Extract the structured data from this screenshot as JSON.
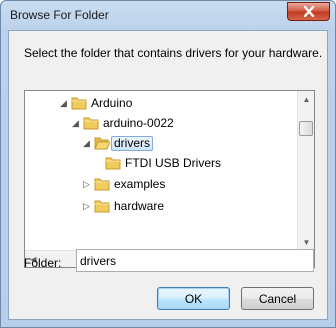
{
  "window": {
    "title": "Browse For Folder"
  },
  "dialog": {
    "prompt": "Select the folder that contains drivers for your hardware.",
    "tree": {
      "nodes": [
        {
          "label": "Arduino",
          "expander": "expanded"
        },
        {
          "label": "arduino-0022",
          "expander": "expanded"
        },
        {
          "label": "drivers",
          "expander": "expanded",
          "selected": true
        },
        {
          "label": "FTDI USB Drivers",
          "expander": "none"
        },
        {
          "label": "examples",
          "expander": "collapsed"
        },
        {
          "label": "hardware",
          "expander": "collapsed"
        }
      ]
    },
    "folder_label": "Folder:",
    "folder_value": "drivers",
    "ok_label": "OK",
    "cancel_label": "Cancel"
  },
  "colors": {
    "folder_fill": "#f1cb5b",
    "folder_edge": "#c79a2d",
    "selection": "#cde6fb",
    "close_button": "#c1391f"
  },
  "icons": {
    "close": "close-icon",
    "folder": "folder-icon",
    "expanded": "triangle-down-icon",
    "collapsed": "triangle-right-icon"
  }
}
